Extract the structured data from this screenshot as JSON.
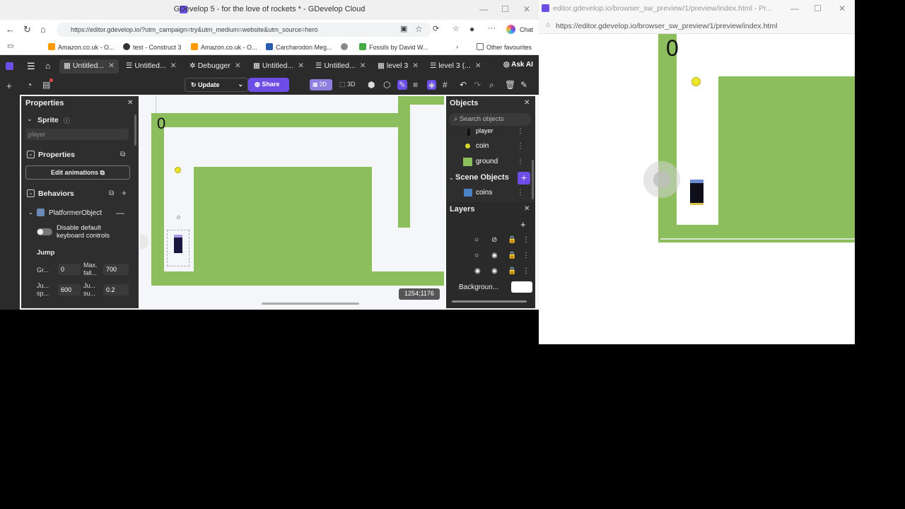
{
  "editor_window": {
    "title": "GDevelop 5 - for the love of rockets * - GDevelop Cloud",
    "url": "https://editor.gdevelop.io/?utm_campaign=try&utm_medium=website&utm_source=hero",
    "chat_label": "Chat",
    "favorites": [
      "Amazon.co.uk - O...",
      "test - Construct 3",
      "Amazon.co.uk - O...",
      "Carcharodon Meg...",
      "Fossils by David W..."
    ],
    "other_favourites": "Other favourites",
    "tabs": [
      {
        "label": "Untitled..."
      },
      {
        "label": "Untitled..."
      },
      {
        "label": "Debugger"
      },
      {
        "label": "Untitled..."
      },
      {
        "label": "Untitled..."
      },
      {
        "label": "level 3"
      },
      {
        "label": "level 3 (..."
      }
    ],
    "ask_ai": "Ask AI",
    "update_label": "Update",
    "share_label": "Share",
    "mode_2d": "2D",
    "mode_3d": "3D"
  },
  "properties": {
    "header": "Properties",
    "object_type": "Sprite",
    "name_placeholder": "player",
    "section_properties": "Properties",
    "edit_animations": "Edit animations",
    "section_behaviors": "Behaviors",
    "behavior_name": "PlatformerObject",
    "disable_keyboard": "Disable default keyboard controls",
    "jump_header": "Jump",
    "gravity_label": "Gr...",
    "gravity_value": "0",
    "max_fall_label": "Max. fall...",
    "max_fall_value": "700",
    "jump_speed_label": "Ju... sp...",
    "jump_speed_value": "600",
    "jump_sustain_label": "Ju... su...",
    "jump_sustain_value": "0.2"
  },
  "scene": {
    "score_text": "0",
    "coords": "1254;1176"
  },
  "objects_panel": {
    "header": "Objects",
    "search_placeholder": "Search objects",
    "items": [
      {
        "label": "player",
        "color": "#111111"
      },
      {
        "label": "coin",
        "color": "#d9d62a"
      },
      {
        "label": "ground",
        "color": "#8dbe5d"
      }
    ],
    "scene_objects_header": "Scene Objects",
    "scene_objects": [
      {
        "label": "coins"
      }
    ],
    "layers_header": "Layers",
    "background_label": "Backgroun..."
  },
  "preview_window": {
    "title": "editor.gdevelop.io/browser_sw_preview/1/preview/index.html - Pr...",
    "url": "https://editor.gdevelop.io/browser_sw_preview/1/preview/index.html",
    "score_text": "0"
  },
  "colors": {
    "ground": "#8dbe5d",
    "accent": "#6c4ee6",
    "panel": "#2e2e2e"
  }
}
